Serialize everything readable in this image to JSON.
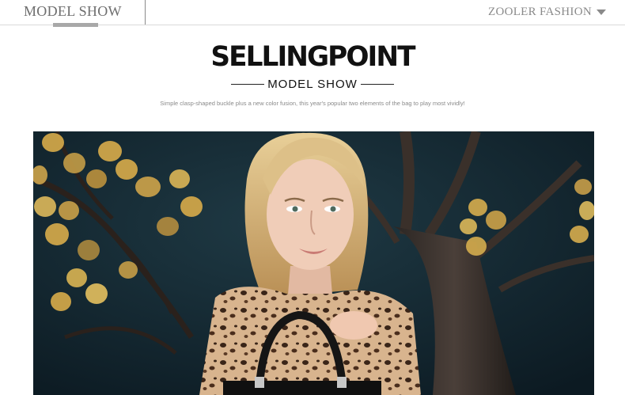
{
  "topbar": {
    "tab_label": "MODEL SHOW",
    "brand_label": "ZOOLER FASHION"
  },
  "hero": {
    "headline": "SELLINGPOINT",
    "subheadline": "MODEL SHOW",
    "description": "Simple clasp-shaped buckle plus a new color fusion, this year's popular two elements of the bag to play most vividly!"
  },
  "photo": {
    "subject": "model with leopard-print blouse and black handbag in front of autumn tree"
  },
  "colors": {
    "background": "#ffffff",
    "text_dark": "#111111",
    "text_gray": "#8a8a8a",
    "backdrop": "#13252f",
    "leaves": "#d4a94a"
  }
}
